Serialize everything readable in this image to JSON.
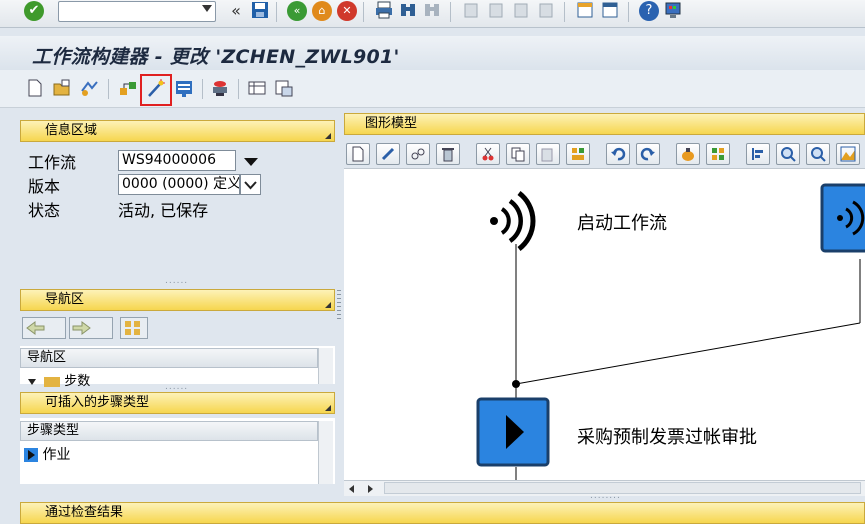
{
  "systoolbar": {
    "icons": [
      "enter-icon",
      "save-icon",
      "back-icon",
      "exit-icon",
      "cancel-icon",
      "print-icon",
      "find-icon",
      "find-next-icon",
      "first-page-icon",
      "prev-page-icon",
      "next-page-icon",
      "last-page-icon",
      "new-session-icon",
      "shortcut-icon",
      "help-icon",
      "layout-icon"
    ]
  },
  "title": "工作流构建器 - 更改 'ZCHEN_ZWL901'",
  "info_panel": {
    "header": "信息区域",
    "workflow_label": "工作流",
    "workflow_value": "WS94000006",
    "version_label": "版本",
    "version_value": "0000 (0000) 定义",
    "status_label": "状态",
    "status_value": "活动, 已保存"
  },
  "nav_panel": {
    "header": "导航区",
    "list_header": "导航区",
    "tree_item": "步数"
  },
  "steptype_panel": {
    "header": "可插入的步骤类型",
    "list_header": "步骤类型",
    "item": "作业"
  },
  "bottom_panel": {
    "header": "通过检查结果"
  },
  "graphic": {
    "header": "图形模型",
    "start_label": "启动工作流",
    "activity_label": "采购预制发票过帐审批"
  },
  "colors": {
    "accent_blue": "#2b84e0",
    "panel_header": "#f6d64f",
    "highlight": "#e02020"
  }
}
